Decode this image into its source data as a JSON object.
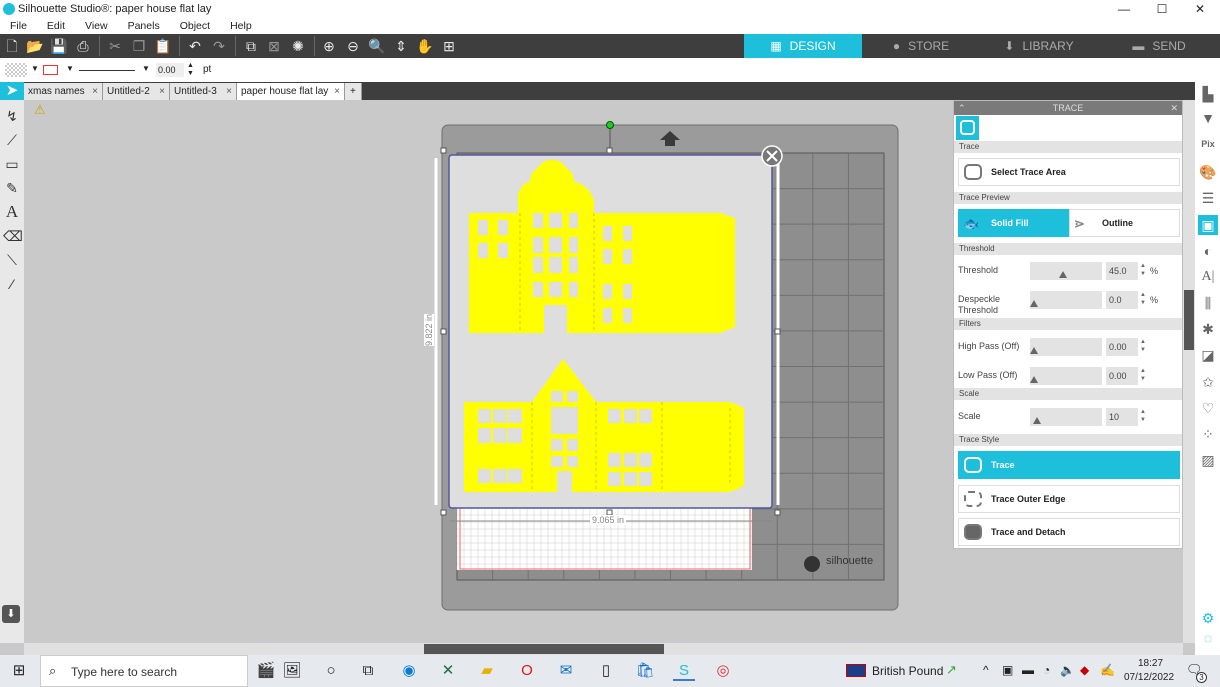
{
  "window": {
    "title": "Silhouette Studio®: paper house flat lay",
    "minimize": "—",
    "maximize": "☐",
    "close": "✕"
  },
  "menu": [
    "File",
    "Edit",
    "View",
    "Panels",
    "Object",
    "Help"
  ],
  "nav_tabs": [
    {
      "label": "DESIGN",
      "icon": "grid-icon"
    },
    {
      "label": "STORE",
      "icon": "silhouette-s-icon"
    },
    {
      "label": "LIBRARY",
      "icon": "download-icon"
    },
    {
      "label": "SEND",
      "icon": "cutter-icon"
    }
  ],
  "line_bar": {
    "line_width": "0.00",
    "unit": "pt"
  },
  "doc_tabs": [
    {
      "label": "xmas names",
      "active": false
    },
    {
      "label": "Untitled-2",
      "active": false
    },
    {
      "label": "Untitled-3",
      "active": false
    },
    {
      "label": "paper house flat lay",
      "active": true
    }
  ],
  "doc_tabs_add": "+",
  "tab_close": "×",
  "canvas": {
    "height_label": "9.822 in",
    "width_label": "9.065 in",
    "brand": "silhouette",
    "fill_color": "#ffff00"
  },
  "trace_panel": {
    "title": "TRACE",
    "sections": {
      "trace": "Trace",
      "preview": "Trace Preview",
      "threshold": "Threshold",
      "filters": "Filters",
      "scale": "Scale",
      "style": "Trace Style"
    },
    "select_trace_area": "Select Trace Area",
    "preview_options": [
      {
        "label": "Solid Fill",
        "active": true
      },
      {
        "label": "Outline",
        "active": false
      }
    ],
    "threshold": {
      "label": "Threshold",
      "value": "45.0",
      "unit": "%",
      "fraction": 0.45
    },
    "despeckle": {
      "label": "Despeckle Threshold",
      "value": "0.0",
      "unit": "%",
      "fraction": 0
    },
    "high_pass": {
      "label": "High Pass (Off)",
      "value": "0.00",
      "fraction": 0
    },
    "low_pass": {
      "label": "Low Pass (Off)",
      "value": "0.00",
      "fraction": 0
    },
    "scale": {
      "label": "Scale",
      "value": "10",
      "fraction": 0.05
    },
    "styles": [
      {
        "label": "Trace",
        "active": true
      },
      {
        "label": "Trace Outer Edge",
        "active": false
      },
      {
        "label": "Trace and Detach",
        "active": false
      }
    ]
  },
  "taskbar": {
    "search_placeholder": "Type here to search",
    "currency": "British Pound",
    "time": "18:27",
    "date": "07/12/2022",
    "notifications": "3"
  },
  "accent": "#1ebfdb"
}
